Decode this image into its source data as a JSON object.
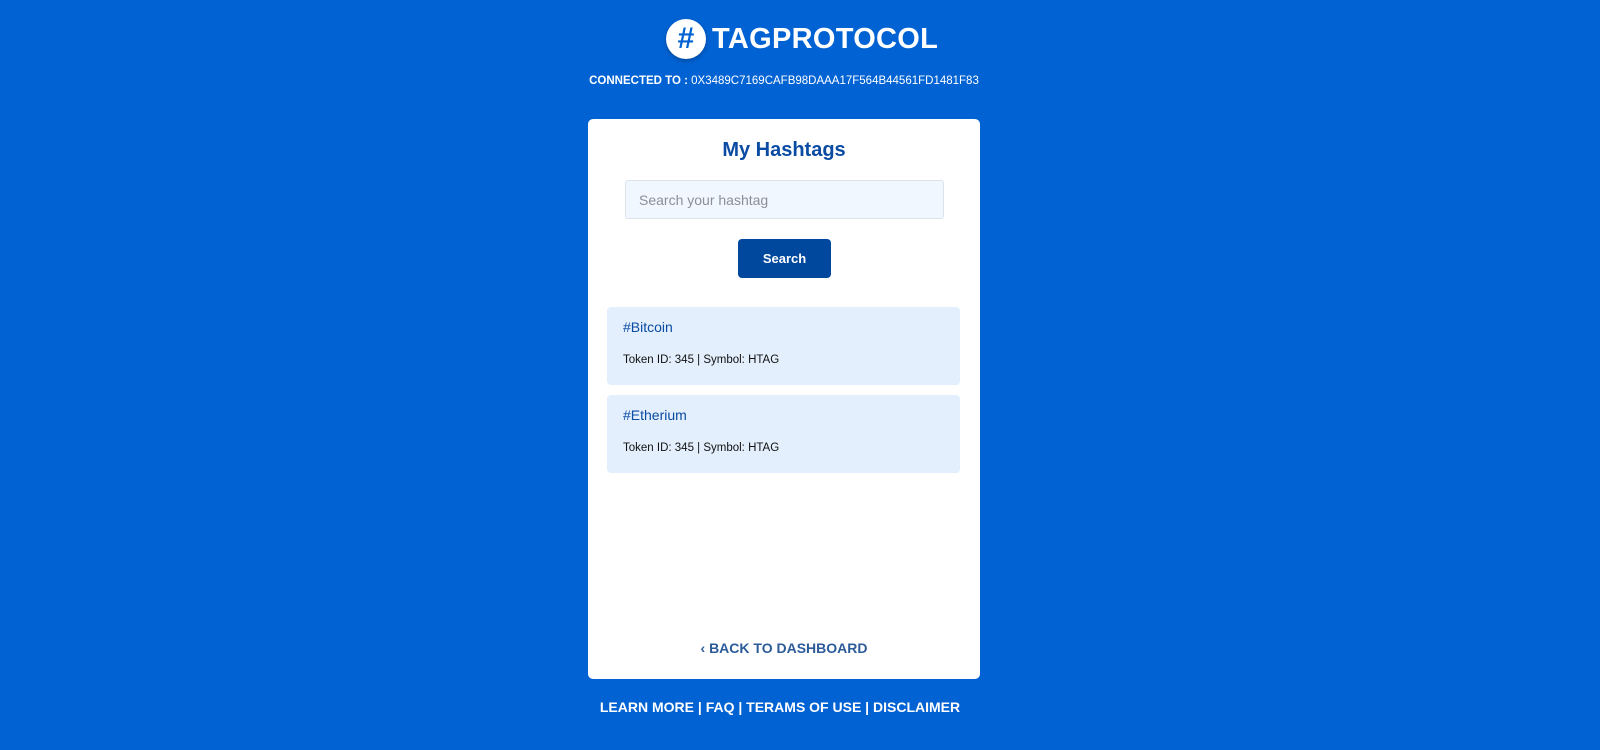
{
  "header": {
    "logo_icon": "#",
    "brand": "TAGPROTOCOL",
    "connected_label": "CONNECTED TO :",
    "address": "0X3489C7169CAFB98DAAA17F564B44561FD1481F83"
  },
  "card": {
    "title": "My Hashtags",
    "search_placeholder": "Search your hashtag",
    "search_button": "Search",
    "items": [
      {
        "tag": "#Bitcoin",
        "meta": "Token ID: 345 | Symbol: HTAG"
      },
      {
        "tag": "#Etherium",
        "meta": "Token ID: 345 | Symbol: HTAG"
      }
    ],
    "back": "‹ BACK TO DASHBOARD"
  },
  "footer": {
    "links": [
      "LEARN MORE",
      "FAQ",
      "TERAMS OF USE",
      "DISCLAIMER"
    ],
    "sep": " | "
  }
}
